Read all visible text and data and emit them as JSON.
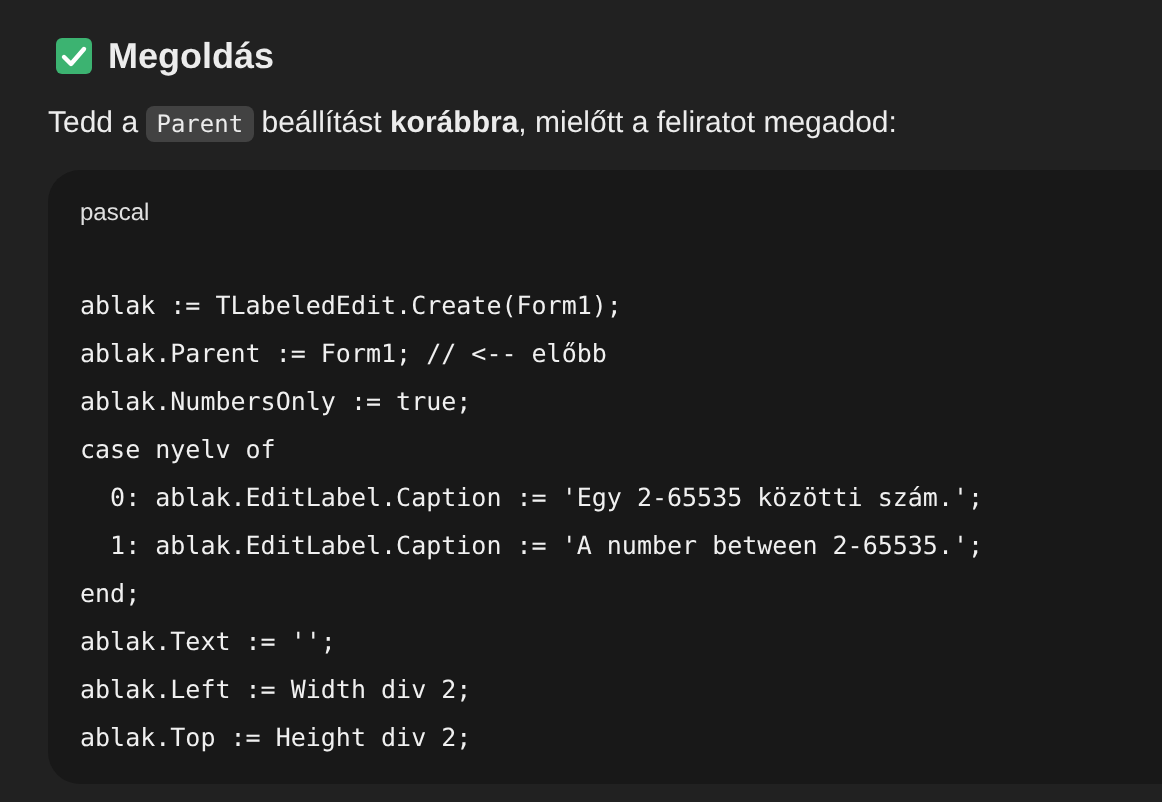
{
  "heading": {
    "title": "Megoldás"
  },
  "intro": {
    "before": "Tedd a",
    "code": "Parent",
    "after": "beállítást **korábbra**, mielőtt a feliratot megadod:"
  },
  "code_block": {
    "language": "pascal",
    "lines": [
      "ablak := TLabeledEdit.Create(Form1);",
      "ablak.Parent := Form1; // <-- előbb",
      "ablak.NumbersOnly := true;",
      "case nyelv of",
      "  0: ablak.EditLabel.Caption := 'Egy 2-65535 közötti szám.';",
      "  1: ablak.EditLabel.Caption := 'A number between 2-65535.';",
      "end;",
      "ablak.Text := '';",
      "ablak.Left := Width div 2;",
      "ablak.Top := Height div 2;"
    ]
  }
}
